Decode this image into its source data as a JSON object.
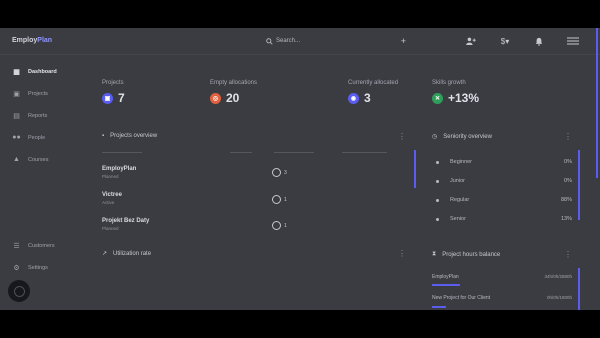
{
  "app": {
    "logo_a": "Employ",
    "logo_b": "Plan"
  },
  "search": {
    "placeholder": "Search..."
  },
  "sidebar": {
    "items": [
      {
        "label": "Dashboard"
      },
      {
        "label": "Projects"
      },
      {
        "label": "Reports"
      },
      {
        "label": "People"
      },
      {
        "label": "Courses"
      }
    ],
    "bottom": [
      {
        "label": "Customers"
      },
      {
        "label": "Settings"
      }
    ]
  },
  "stats": [
    {
      "label": "Projects",
      "value": "7",
      "color": "#5b5cf0"
    },
    {
      "label": "Empty allocations",
      "value": "20",
      "color": "#e0603f"
    },
    {
      "label": "Currently allocated",
      "value": "3",
      "color": "#5b5cf0"
    },
    {
      "label": "Skills growth",
      "value": "+13%",
      "color": "#2f9e5b"
    }
  ],
  "projects_overview": {
    "title": "Projects overview",
    "rows": [
      {
        "name": "EmployPlan",
        "status": "Planned",
        "people": "3"
      },
      {
        "name": "Victree",
        "status": "Active",
        "people": "1"
      },
      {
        "name": "Projekt Bez Daty",
        "status": "Planned",
        "people": "1"
      }
    ]
  },
  "seniority": {
    "title": "Seniority overview",
    "rows": [
      {
        "name": "Beginner",
        "pct": "0%"
      },
      {
        "name": "Junior",
        "pct": "0%"
      },
      {
        "name": "Regular",
        "pct": "88%"
      },
      {
        "name": "Senior",
        "pct": "13%"
      }
    ]
  },
  "utilization": {
    "title": "Utilization rate"
  },
  "hours_balance": {
    "title": "Project hours balance",
    "rows": [
      {
        "name": "EmployPlan",
        "value": "34h/0h/2880h",
        "fill": 0.2
      },
      {
        "name": "New Project for Our Client",
        "value": "0h/0h/1800h",
        "fill": 0.1
      }
    ]
  },
  "colors": {
    "accent": "#5b5cf0",
    "overlay_bg": "#3b3c41"
  }
}
